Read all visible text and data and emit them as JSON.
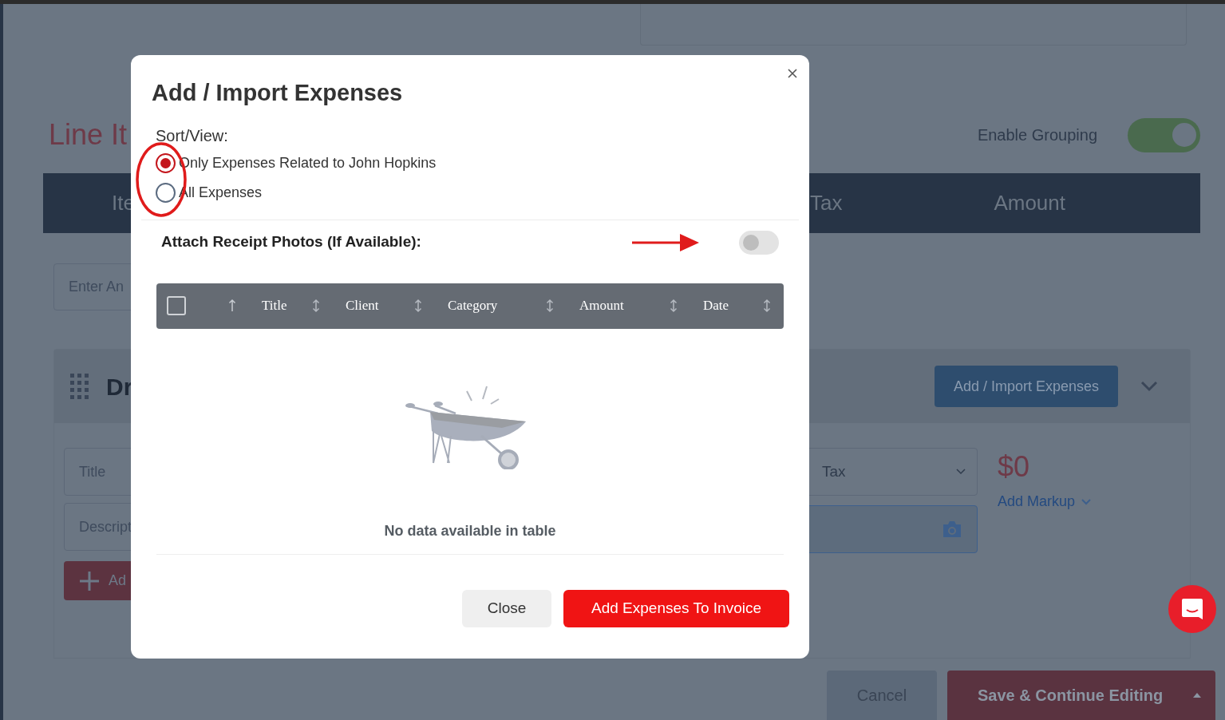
{
  "background": {
    "heading": "Line It",
    "enable_grouping": {
      "label": "Enable Grouping",
      "on": true
    },
    "columns": [
      "Ite",
      "Tax",
      "Amount"
    ],
    "search": {
      "placeholder": "Enter An"
    },
    "group": {
      "title": "Dr",
      "import_button": "Add / Import Expenses",
      "fields": [
        {
          "placeholder": "Title"
        },
        {
          "placeholder": "Descript"
        }
      ],
      "add_button": "Ad",
      "tax_select": "Tax",
      "amount": "$0",
      "markup_link": "Add Markup"
    }
  },
  "modal": {
    "title": "Add / Import Expenses",
    "sort_label": "Sort/View:",
    "options": [
      {
        "label": "Only Expenses Related to John Hopkins",
        "selected": true
      },
      {
        "label": "All Expenses",
        "selected": false
      }
    ],
    "attach": {
      "label": "Attach Receipt Photos (If Available):",
      "on": false
    },
    "table": {
      "select_all": {
        "checked": false,
        "sorted": true
      },
      "columns": [
        {
          "label": "Title",
          "sorted": false
        },
        {
          "label": "Client",
          "sorted": false
        },
        {
          "label": "Category",
          "sorted": false
        },
        {
          "label": "Amount",
          "sorted": false
        },
        {
          "label": "Date",
          "sorted": false
        }
      ],
      "empty_text": "No data available in table"
    },
    "buttons": {
      "close": "Close",
      "primary": "Add Expenses To Invoice"
    }
  },
  "footer": {
    "cancel": "Cancel",
    "save": "Save & Continue Editing"
  }
}
